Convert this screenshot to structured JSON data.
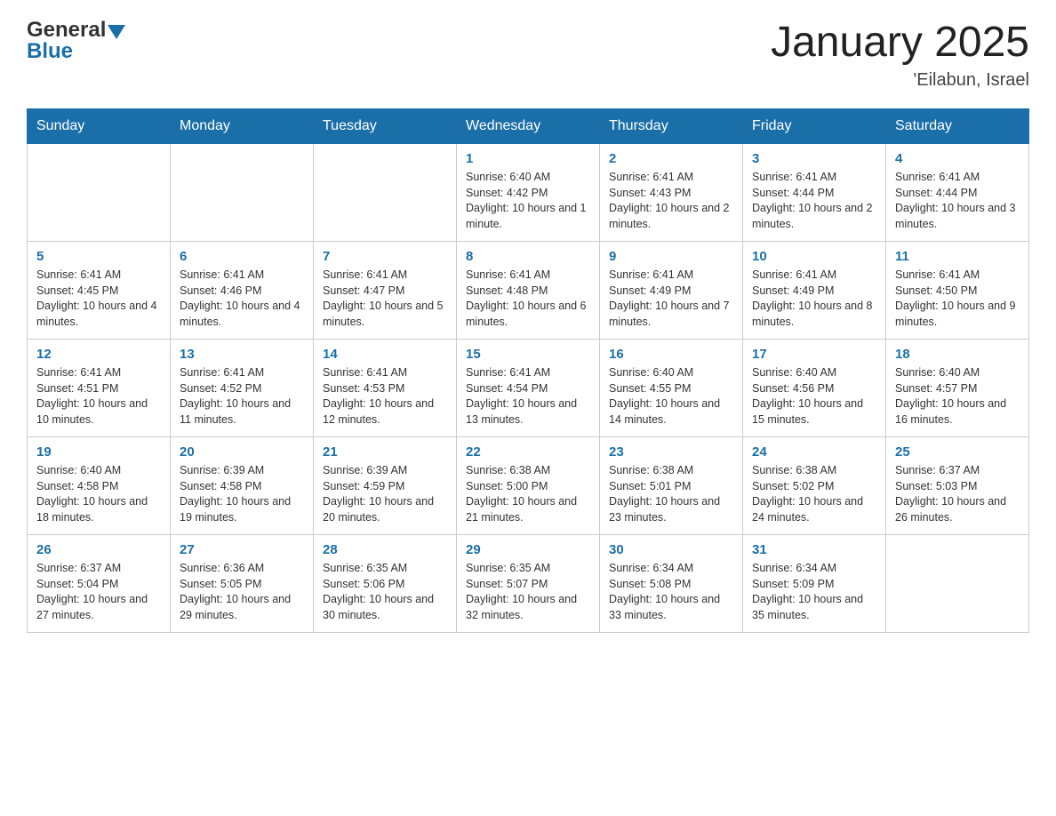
{
  "header": {
    "logo_general": "General",
    "logo_blue": "Blue",
    "title": "January 2025",
    "subtitle": "'Eilabun, Israel"
  },
  "weekdays": [
    "Sunday",
    "Monday",
    "Tuesday",
    "Wednesday",
    "Thursday",
    "Friday",
    "Saturday"
  ],
  "weeks": [
    [
      {
        "day": "",
        "info": ""
      },
      {
        "day": "",
        "info": ""
      },
      {
        "day": "",
        "info": ""
      },
      {
        "day": "1",
        "info": "Sunrise: 6:40 AM\nSunset: 4:42 PM\nDaylight: 10 hours and 1 minute."
      },
      {
        "day": "2",
        "info": "Sunrise: 6:41 AM\nSunset: 4:43 PM\nDaylight: 10 hours and 2 minutes."
      },
      {
        "day": "3",
        "info": "Sunrise: 6:41 AM\nSunset: 4:44 PM\nDaylight: 10 hours and 2 minutes."
      },
      {
        "day": "4",
        "info": "Sunrise: 6:41 AM\nSunset: 4:44 PM\nDaylight: 10 hours and 3 minutes."
      }
    ],
    [
      {
        "day": "5",
        "info": "Sunrise: 6:41 AM\nSunset: 4:45 PM\nDaylight: 10 hours and 4 minutes."
      },
      {
        "day": "6",
        "info": "Sunrise: 6:41 AM\nSunset: 4:46 PM\nDaylight: 10 hours and 4 minutes."
      },
      {
        "day": "7",
        "info": "Sunrise: 6:41 AM\nSunset: 4:47 PM\nDaylight: 10 hours and 5 minutes."
      },
      {
        "day": "8",
        "info": "Sunrise: 6:41 AM\nSunset: 4:48 PM\nDaylight: 10 hours and 6 minutes."
      },
      {
        "day": "9",
        "info": "Sunrise: 6:41 AM\nSunset: 4:49 PM\nDaylight: 10 hours and 7 minutes."
      },
      {
        "day": "10",
        "info": "Sunrise: 6:41 AM\nSunset: 4:49 PM\nDaylight: 10 hours and 8 minutes."
      },
      {
        "day": "11",
        "info": "Sunrise: 6:41 AM\nSunset: 4:50 PM\nDaylight: 10 hours and 9 minutes."
      }
    ],
    [
      {
        "day": "12",
        "info": "Sunrise: 6:41 AM\nSunset: 4:51 PM\nDaylight: 10 hours and 10 minutes."
      },
      {
        "day": "13",
        "info": "Sunrise: 6:41 AM\nSunset: 4:52 PM\nDaylight: 10 hours and 11 minutes."
      },
      {
        "day": "14",
        "info": "Sunrise: 6:41 AM\nSunset: 4:53 PM\nDaylight: 10 hours and 12 minutes."
      },
      {
        "day": "15",
        "info": "Sunrise: 6:41 AM\nSunset: 4:54 PM\nDaylight: 10 hours and 13 minutes."
      },
      {
        "day": "16",
        "info": "Sunrise: 6:40 AM\nSunset: 4:55 PM\nDaylight: 10 hours and 14 minutes."
      },
      {
        "day": "17",
        "info": "Sunrise: 6:40 AM\nSunset: 4:56 PM\nDaylight: 10 hours and 15 minutes."
      },
      {
        "day": "18",
        "info": "Sunrise: 6:40 AM\nSunset: 4:57 PM\nDaylight: 10 hours and 16 minutes."
      }
    ],
    [
      {
        "day": "19",
        "info": "Sunrise: 6:40 AM\nSunset: 4:58 PM\nDaylight: 10 hours and 18 minutes."
      },
      {
        "day": "20",
        "info": "Sunrise: 6:39 AM\nSunset: 4:58 PM\nDaylight: 10 hours and 19 minutes."
      },
      {
        "day": "21",
        "info": "Sunrise: 6:39 AM\nSunset: 4:59 PM\nDaylight: 10 hours and 20 minutes."
      },
      {
        "day": "22",
        "info": "Sunrise: 6:38 AM\nSunset: 5:00 PM\nDaylight: 10 hours and 21 minutes."
      },
      {
        "day": "23",
        "info": "Sunrise: 6:38 AM\nSunset: 5:01 PM\nDaylight: 10 hours and 23 minutes."
      },
      {
        "day": "24",
        "info": "Sunrise: 6:38 AM\nSunset: 5:02 PM\nDaylight: 10 hours and 24 minutes."
      },
      {
        "day": "25",
        "info": "Sunrise: 6:37 AM\nSunset: 5:03 PM\nDaylight: 10 hours and 26 minutes."
      }
    ],
    [
      {
        "day": "26",
        "info": "Sunrise: 6:37 AM\nSunset: 5:04 PM\nDaylight: 10 hours and 27 minutes."
      },
      {
        "day": "27",
        "info": "Sunrise: 6:36 AM\nSunset: 5:05 PM\nDaylight: 10 hours and 29 minutes."
      },
      {
        "day": "28",
        "info": "Sunrise: 6:35 AM\nSunset: 5:06 PM\nDaylight: 10 hours and 30 minutes."
      },
      {
        "day": "29",
        "info": "Sunrise: 6:35 AM\nSunset: 5:07 PM\nDaylight: 10 hours and 32 minutes."
      },
      {
        "day": "30",
        "info": "Sunrise: 6:34 AM\nSunset: 5:08 PM\nDaylight: 10 hours and 33 minutes."
      },
      {
        "day": "31",
        "info": "Sunrise: 6:34 AM\nSunset: 5:09 PM\nDaylight: 10 hours and 35 minutes."
      },
      {
        "day": "",
        "info": ""
      }
    ]
  ]
}
